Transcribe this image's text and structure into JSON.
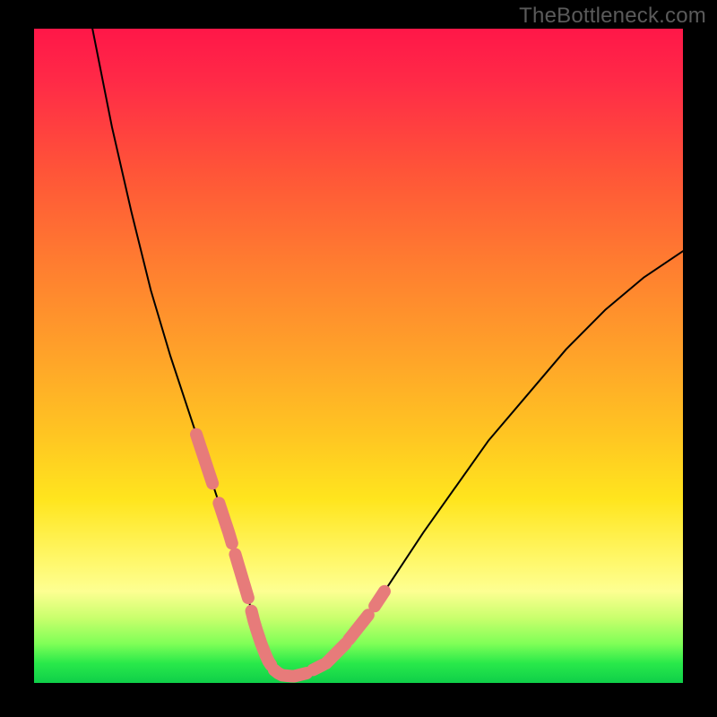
{
  "watermark": "TheBottleneck.com",
  "chart_data": {
    "type": "line",
    "title": "",
    "xlabel": "",
    "ylabel": "",
    "xlim": [
      0,
      100
    ],
    "ylim": [
      0,
      100
    ],
    "series": [
      {
        "name": "curve",
        "x": [
          9,
          12,
          15,
          18,
          21,
          24,
          26,
          28,
          30,
          31.5,
          33,
          34,
          35,
          36,
          37,
          38,
          40,
          42,
          45,
          48,
          52,
          56,
          60,
          65,
          70,
          76,
          82,
          88,
          94,
          100
        ],
        "y": [
          100,
          85,
          72,
          60,
          50,
          41,
          35,
          29,
          23,
          18,
          13,
          9,
          6,
          3.5,
          2,
          1.2,
          1,
          1.5,
          3,
          6,
          11,
          17,
          23,
          30,
          37,
          44,
          51,
          57,
          62,
          66
        ]
      }
    ],
    "marker_segments": [
      {
        "x_start": 25,
        "x_end": 27.5
      },
      {
        "x_start": 28.5,
        "x_end": 30.5
      },
      {
        "x_start": 31,
        "x_end": 33
      },
      {
        "x_start": 33.5,
        "x_end": 36.5
      },
      {
        "x_start": 37,
        "x_end": 42
      },
      {
        "x_start": 43,
        "x_end": 44.5
      },
      {
        "x_start": 45,
        "x_end": 48
      },
      {
        "x_start": 48.5,
        "x_end": 51.5
      },
      {
        "x_start": 52.5,
        "x_end": 54
      }
    ],
    "colors": {
      "curve": "#000000",
      "marker": "#e77b7a",
      "gradient_top": "#ff1748",
      "gradient_bottom": "#0fcf49"
    }
  }
}
